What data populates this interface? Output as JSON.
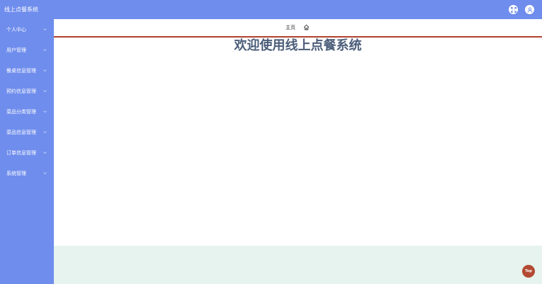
{
  "app": {
    "title": "线上点餐系统"
  },
  "header": {
    "fullscreen_icon": "fullscreen-icon",
    "user_icon": "user-icon"
  },
  "sidebar": {
    "items": [
      {
        "label": "个人中心"
      },
      {
        "label": "用户管理"
      },
      {
        "label": "餐桌信息管理"
      },
      {
        "label": "预约信息管理"
      },
      {
        "label": "菜品分类管理"
      },
      {
        "label": "菜品信息管理"
      },
      {
        "label": "订单信息管理"
      },
      {
        "label": "系统管理"
      }
    ]
  },
  "tabs": {
    "home_label": "主页",
    "home_icon": "home-icon"
  },
  "main": {
    "welcome": "欢迎使用线上点餐系统"
  },
  "back_to_top": {
    "label": "Top"
  },
  "colors": {
    "primary": "#6f8ded",
    "tab_underline": "#b0412f",
    "footer": "#e6f3ee",
    "top_button": "#b34a33",
    "welcome_text": "#4b5d79"
  }
}
